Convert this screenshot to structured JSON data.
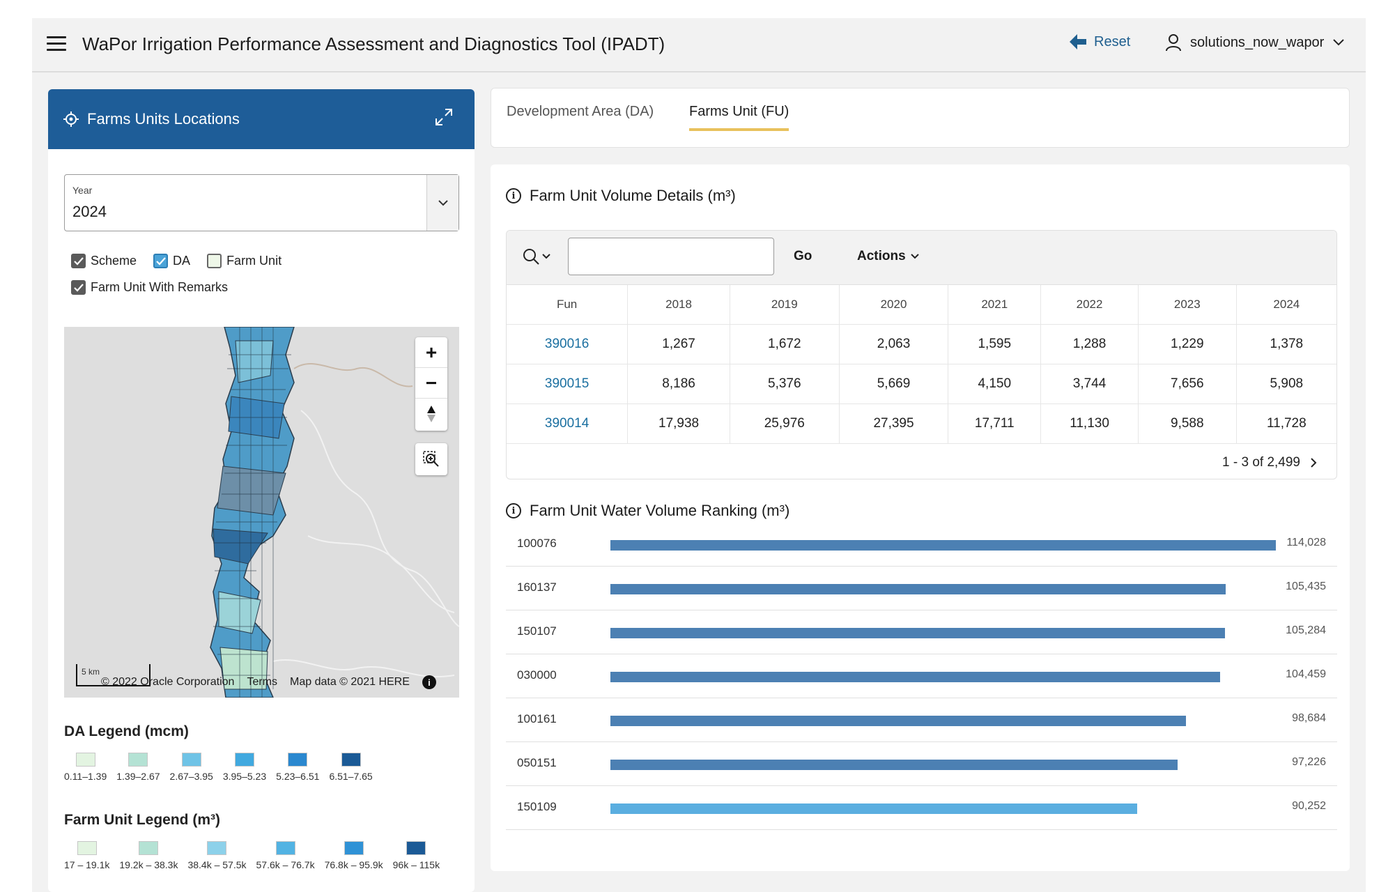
{
  "header": {
    "title": "WaPor Irrigation Performance Assessment and Diagnostics Tool (IPADT)",
    "reset_label": "Reset",
    "username": "solutions_now_wapor"
  },
  "left_panel": {
    "title": "Farms Units Locations",
    "year_label": "Year",
    "year_value": "2024",
    "checkboxes": [
      {
        "label": "Scheme",
        "checked": true
      },
      {
        "label": "DA",
        "checked": true
      },
      {
        "label": "Farm Unit",
        "checked": false
      },
      {
        "label": "Farm Unit With Remarks",
        "checked": true
      }
    ],
    "map": {
      "scale_label": "5 km",
      "copyright": "© 2022 Oracle Corporation",
      "terms": "Terms",
      "map_data": "Map data © 2021 HERE"
    },
    "da_legend": {
      "title": "DA Legend (mcm)",
      "items": [
        {
          "label": "0.11–1.39",
          "color": "#e3f4e1"
        },
        {
          "label": "1.39–2.67",
          "color": "#b4e2d4"
        },
        {
          "label": "2.67–3.95",
          "color": "#6fc3e6"
        },
        {
          "label": "3.95–5.23",
          "color": "#41a9df"
        },
        {
          "label": "5.23–6.51",
          "color": "#2b88cf"
        },
        {
          "label": "6.51–7.65",
          "color": "#1b5a96"
        }
      ]
    },
    "fu_legend": {
      "title": "Farm Unit Legend (m³)",
      "items": [
        {
          "label": "17 – 19.1k",
          "color": "#e3f4e1"
        },
        {
          "label": "19.2k – 38.3k",
          "color": "#b4e2d4"
        },
        {
          "label": "38.4k – 57.5k",
          "color": "#8dd1ea"
        },
        {
          "label": "57.6k – 76.7k",
          "color": "#52b3e3"
        },
        {
          "label": "76.8k – 95.9k",
          "color": "#2f92d6"
        },
        {
          "label": "96k – 115k",
          "color": "#1b5a96"
        }
      ]
    }
  },
  "tabs": [
    {
      "label": "Development Area (DA)",
      "active": false
    },
    {
      "label": "Farms Unit (FU)",
      "active": true
    }
  ],
  "volume_details": {
    "title": "Farm Unit Volume Details (m³)",
    "go_label": "Go",
    "actions_label": "Actions",
    "columns": [
      "Fun",
      "2018",
      "2019",
      "2020",
      "2021",
      "2022",
      "2023",
      "2024"
    ],
    "rows": [
      [
        "390016",
        "1,267",
        "1,672",
        "2,063",
        "1,595",
        "1,288",
        "1,229",
        "1,378"
      ],
      [
        "390015",
        "8,186",
        "5,376",
        "5,669",
        "4,150",
        "3,744",
        "7,656",
        "5,908"
      ],
      [
        "390014",
        "17,938",
        "25,976",
        "27,395",
        "17,711",
        "11,130",
        "9,588",
        "11,728"
      ]
    ],
    "pagination": "1 - 3 of 2,499"
  },
  "ranking": {
    "title": "Farm Unit Water Volume Ranking (m³)",
    "bar_color": "#4c80b3",
    "highlight_color": "#5aaee0",
    "chart_data": {
      "type": "bar",
      "orientation": "horizontal",
      "categories": [
        "100076",
        "160137",
        "150107",
        "030000",
        "100161",
        "050151",
        "150109"
      ],
      "values": [
        114028,
        105435,
        105284,
        104459,
        98684,
        97226,
        90252
      ],
      "value_labels": [
        "114,028",
        "105,435",
        "105,284",
        "104,459",
        "98,684",
        "97,226",
        "90,252"
      ]
    }
  }
}
